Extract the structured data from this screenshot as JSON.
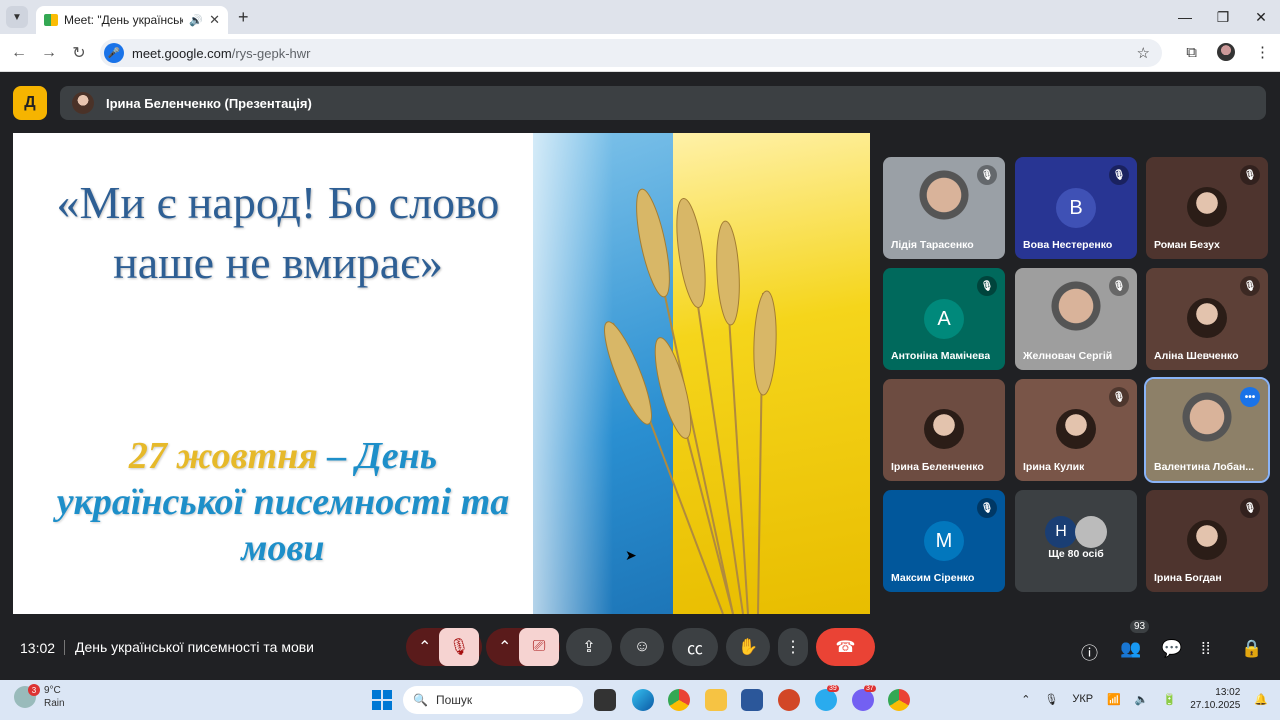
{
  "browser": {
    "tab_title": "Meet: \"День української пи",
    "url_host": "meet.google.com",
    "url_path": "/rys-gepk-hwr",
    "new_tab_icon": "plus-icon",
    "window_controls": [
      "minimize",
      "maximize",
      "close"
    ]
  },
  "meet": {
    "presenter_label": "Ірина Беленченко (Презентація)",
    "slide": {
      "quote": "«Ми є народ! Бо слово наше не вмирає»",
      "date": "27 жовтня",
      "holiday": " – День української писемності та мови"
    },
    "participants": [
      {
        "name": "Лідія Тарасенко",
        "kind": "video",
        "muted": true,
        "bg": "#9aa0a6"
      },
      {
        "name": "Вова Нестеренко",
        "kind": "letter",
        "letter": "B",
        "muted": true,
        "bg": "#283593",
        "circle": "#3f51b5"
      },
      {
        "name": "Роман Безух",
        "kind": "photo",
        "muted": true,
        "bg": "#4e342e"
      },
      {
        "name": "Антоніна Мамічева",
        "kind": "letter",
        "letter": "A",
        "muted": true,
        "bg": "#00695c",
        "circle": "#00897b"
      },
      {
        "name": "Желновач Сергій",
        "kind": "video",
        "muted": true,
        "bg": "#9e9e9e"
      },
      {
        "name": "Аліна Шевченко",
        "kind": "photo",
        "muted": true,
        "bg": "#5d4037"
      },
      {
        "name": "Ірина Беленченко",
        "kind": "photo",
        "muted": false,
        "bg": "#6d4c41"
      },
      {
        "name": "Ірина Кулик",
        "kind": "photo",
        "muted": true,
        "bg": "#795548"
      },
      {
        "name": "Валентина Лобан...",
        "kind": "video",
        "muted": false,
        "bg": "#8d8068",
        "active": true
      },
      {
        "name": "Максим Сіренко",
        "kind": "letter",
        "letter": "M",
        "muted": true,
        "bg": "#01579b",
        "circle": "#0277bd"
      },
      {
        "name": "Ще 80 осіб",
        "kind": "more",
        "letter": "H",
        "muted": false,
        "bg": "#3c4043"
      },
      {
        "name": "Ірина Богдан",
        "kind": "photo",
        "muted": true,
        "bg": "#4e342e"
      }
    ],
    "time": "13:02",
    "title": "День української писемності та мови",
    "participant_count": "93"
  },
  "taskbar": {
    "weather_temp": "9°C",
    "weather_desc": "Rain",
    "weather_badge": "3",
    "search_placeholder": "Пошук",
    "language": "УКР",
    "clock_time": "13:02",
    "clock_date": "27.10.2025",
    "badges": {
      "telegram": "39",
      "viber": "37"
    }
  }
}
